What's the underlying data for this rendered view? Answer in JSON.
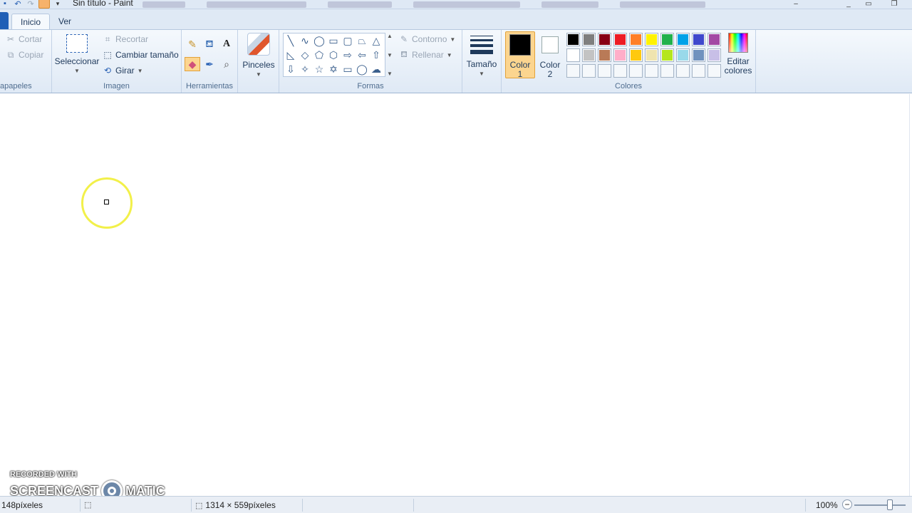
{
  "window": {
    "title": "Sin título - Paint"
  },
  "tabs": [
    {
      "label": "Inicio",
      "active": true
    },
    {
      "label": "Ver",
      "active": false
    }
  ],
  "clipboard": {
    "label": "apapeles",
    "cut": "Cortar",
    "copy": "Copiar"
  },
  "image": {
    "label": "Imagen",
    "select": "Seleccionar",
    "crop": "Recortar",
    "resize": "Cambiar tamaño",
    "rotate": "Girar"
  },
  "tools": {
    "label": "Herramientas",
    "items": [
      {
        "name": "pencil",
        "active": false
      },
      {
        "name": "fill",
        "active": false
      },
      {
        "name": "text",
        "glyph": "A",
        "active": false
      },
      {
        "name": "eraser",
        "active": true
      },
      {
        "name": "color-picker",
        "active": false
      },
      {
        "name": "magnifier",
        "active": false
      }
    ]
  },
  "brushes": {
    "label": "Pinceles"
  },
  "shapes": {
    "label": "Formas",
    "outline": "Contorno",
    "fill": "Rellenar"
  },
  "size": {
    "label": "Tamaño"
  },
  "colors": {
    "label": "Colores",
    "color1_line1": "Color",
    "color1_line2": "1",
    "color2_line1": "Color",
    "color2_line2": "2",
    "color1_value": "#000000",
    "color2_value": "#ffffff",
    "edit_line1": "Editar",
    "edit_line2": "colores",
    "palette": [
      "#000000",
      "#7f7f7f",
      "#880015",
      "#ed1c24",
      "#ff7f27",
      "#fff200",
      "#22b14c",
      "#00a2e8",
      "#3f48cc",
      "#a349a4",
      "#ffffff",
      "#c3c3c3",
      "#b97a57",
      "#ffaec9",
      "#ffc90e",
      "#efe4b0",
      "#b5e61d",
      "#99d9ea",
      "#7092be",
      "#c8bfe7",
      "",
      "",
      "",
      "",
      "",
      "",
      "",
      "",
      "",
      ""
    ]
  },
  "watermark": {
    "line1": "RECORDED WITH",
    "left": "SCREENCAST",
    "right": "MATIC"
  },
  "status": {
    "cursor_pos": "148píxeles",
    "canvas_size": "1314 × 559píxeles",
    "zoom": "100%"
  }
}
